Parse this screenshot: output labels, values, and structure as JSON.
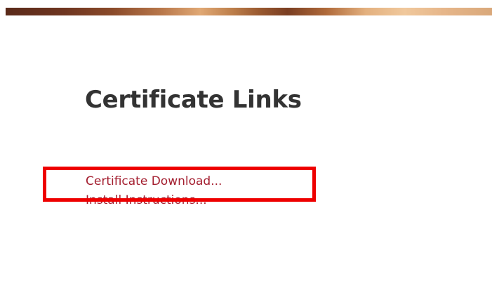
{
  "page": {
    "title": "Certificate Links"
  },
  "links": [
    {
      "label": "Certificate Download..."
    },
    {
      "label": "Install Instructions..."
    }
  ],
  "colors": {
    "link": "#a31d2e",
    "title": "#333333",
    "highlight": "#ee0000"
  }
}
